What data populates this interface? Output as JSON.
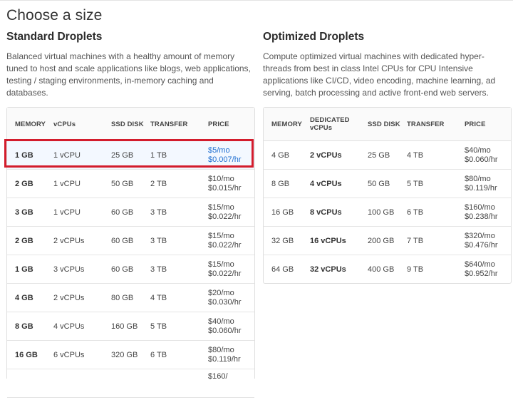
{
  "page_title": "Choose a size",
  "standard": {
    "title": "Standard Droplets",
    "description": "Balanced virtual machines with a healthy amount of memory tuned to host and scale applications like blogs, web applications, testing / staging environments, in-memory caching and databases.",
    "headers": [
      "MEMORY",
      "vCPUs",
      "SSD DISK",
      "TRANSFER",
      "PRICE"
    ],
    "rows": [
      {
        "memory": "1 GB",
        "vcpus": "1 vCPU",
        "disk": "25 GB",
        "transfer": "1 TB",
        "price_mo": "$5/mo",
        "price_hr": "$0.007/hr"
      },
      {
        "memory": "2 GB",
        "vcpus": "1 vCPU",
        "disk": "50 GB",
        "transfer": "2 TB",
        "price_mo": "$10/mo",
        "price_hr": "$0.015/hr"
      },
      {
        "memory": "3 GB",
        "vcpus": "1 vCPU",
        "disk": "60 GB",
        "transfer": "3 TB",
        "price_mo": "$15/mo",
        "price_hr": "$0.022/hr"
      },
      {
        "memory": "2 GB",
        "vcpus": "2 vCPUs",
        "disk": "60 GB",
        "transfer": "3 TB",
        "price_mo": "$15/mo",
        "price_hr": "$0.022/hr"
      },
      {
        "memory": "1 GB",
        "vcpus": "3 vCPUs",
        "disk": "60 GB",
        "transfer": "3 TB",
        "price_mo": "$15/mo",
        "price_hr": "$0.022/hr"
      },
      {
        "memory": "4 GB",
        "vcpus": "2 vCPUs",
        "disk": "80 GB",
        "transfer": "4 TB",
        "price_mo": "$20/mo",
        "price_hr": "$0.030/hr"
      },
      {
        "memory": "8 GB",
        "vcpus": "4 vCPUs",
        "disk": "160 GB",
        "transfer": "5 TB",
        "price_mo": "$40/mo",
        "price_hr": "$0.060/hr"
      },
      {
        "memory": "16 GB",
        "vcpus": "6 vCPUs",
        "disk": "320 GB",
        "transfer": "6 TB",
        "price_mo": "$80/mo",
        "price_hr": "$0.119/hr"
      },
      {
        "memory": "",
        "vcpus": "",
        "disk": "",
        "transfer": "",
        "price_mo": "$160/",
        "price_hr": ""
      }
    ]
  },
  "optimized": {
    "title": "Optimized Droplets",
    "description": "Compute optimized virtual machines with dedicated hyper-threads from best in class Intel CPUs for CPU Intensive applications like CI/CD, video encoding, machine learning, ad serving, batch processing and active front-end web servers.",
    "headers": [
      "MEMORY",
      "DEDICATED",
      "vCPUs",
      "SSD DISK",
      "TRANSFER",
      "PRICE"
    ],
    "rows": [
      {
        "memory": "4 GB",
        "vcpus": "2 vCPUs",
        "disk": "25 GB",
        "transfer": "4 TB",
        "price_mo": "$40/mo",
        "price_hr": "$0.060/hr"
      },
      {
        "memory": "8 GB",
        "vcpus": "4 vCPUs",
        "disk": "50 GB",
        "transfer": "5 TB",
        "price_mo": "$80/mo",
        "price_hr": "$0.119/hr"
      },
      {
        "memory": "16 GB",
        "vcpus": "8 vCPUs",
        "disk": "100 GB",
        "transfer": "6 TB",
        "price_mo": "$160/mo",
        "price_hr": "$0.238/hr"
      },
      {
        "memory": "32 GB",
        "vcpus": "16 vCPUs",
        "disk": "200 GB",
        "transfer": "7 TB",
        "price_mo": "$320/mo",
        "price_hr": "$0.476/hr"
      },
      {
        "memory": "64 GB",
        "vcpus": "32 vCPUs",
        "disk": "400 GB",
        "transfer": "9 TB",
        "price_mo": "$640/mo",
        "price_hr": "$0.952/hr"
      }
    ]
  },
  "colors": {
    "selected_price": "#1f6fd1",
    "selected_row_bg": "#f3f8ff",
    "highlight_border": "#d31c2c"
  }
}
